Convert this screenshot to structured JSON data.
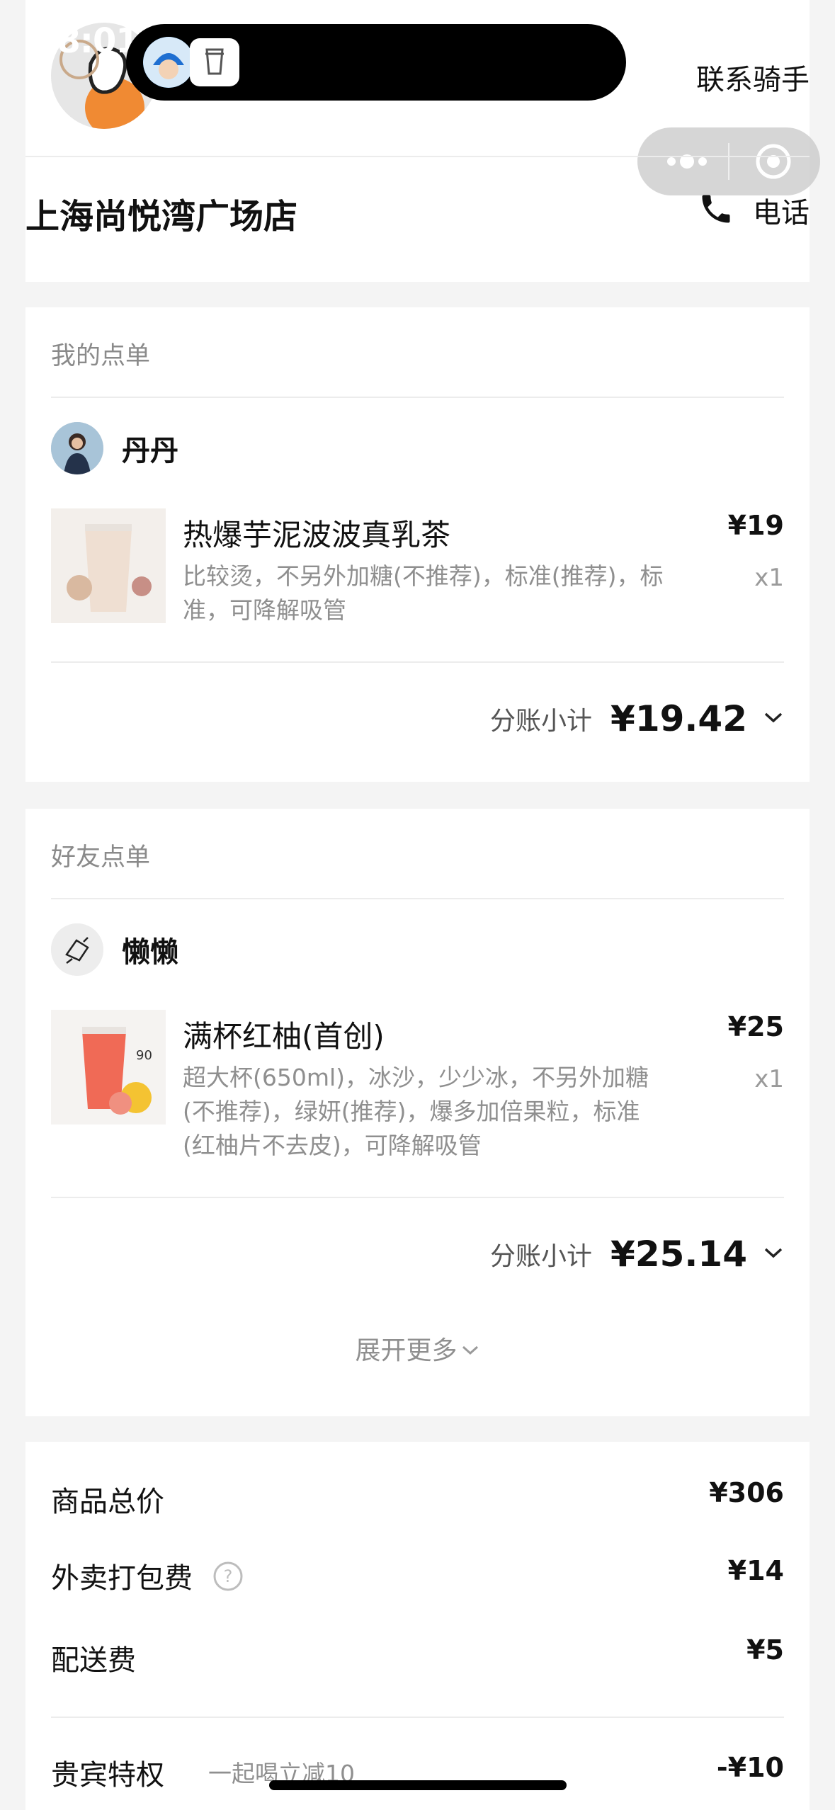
{
  "status_bar": {
    "time": "18:01"
  },
  "header": {
    "contact_rider_label": "联系骑手",
    "store_name": "上海尚悦湾广场店",
    "phone_label": "电话"
  },
  "my_order": {
    "section_title": "我的点单",
    "user_name": "丹丹",
    "item": {
      "name": "热爆芋泥波波真乳茶",
      "desc": "比较烫，不另外加糖(不推荐)，标准(推荐)，标准，可降解吸管",
      "price": "¥19",
      "qty": "x1"
    },
    "subtotal_label": "分账小计",
    "subtotal_value": "¥19.42"
  },
  "friend_order": {
    "section_title": "好友点单",
    "user_name": "懒懒",
    "item": {
      "name": "满杯红柚(首创)",
      "desc": "超大杯(650ml)，冰沙，少少冰，不另外加糖(不推荐)，绿妍(推荐)，爆多加倍果粒，标准(红柚片不去皮)，可降解吸管",
      "price": "¥25",
      "qty": "x1"
    },
    "subtotal_label": "分账小计",
    "subtotal_value": "¥25.14",
    "expand_more_label": "展开更多"
  },
  "summary": {
    "goods_total_label": "商品总价",
    "goods_total_value": "¥306",
    "packing_fee_label": "外卖打包费",
    "packing_fee_value": "¥14",
    "delivery_fee_label": "配送费",
    "delivery_fee_value": "¥5",
    "vip_label": "贵宾特权",
    "vip_desc": "一起喝立减10",
    "vip_value": "-¥10"
  },
  "icons": [
    "rider-avatar",
    "phone-icon",
    "help-icon",
    "chevron-down-icon",
    "capsule-menu-icon"
  ]
}
